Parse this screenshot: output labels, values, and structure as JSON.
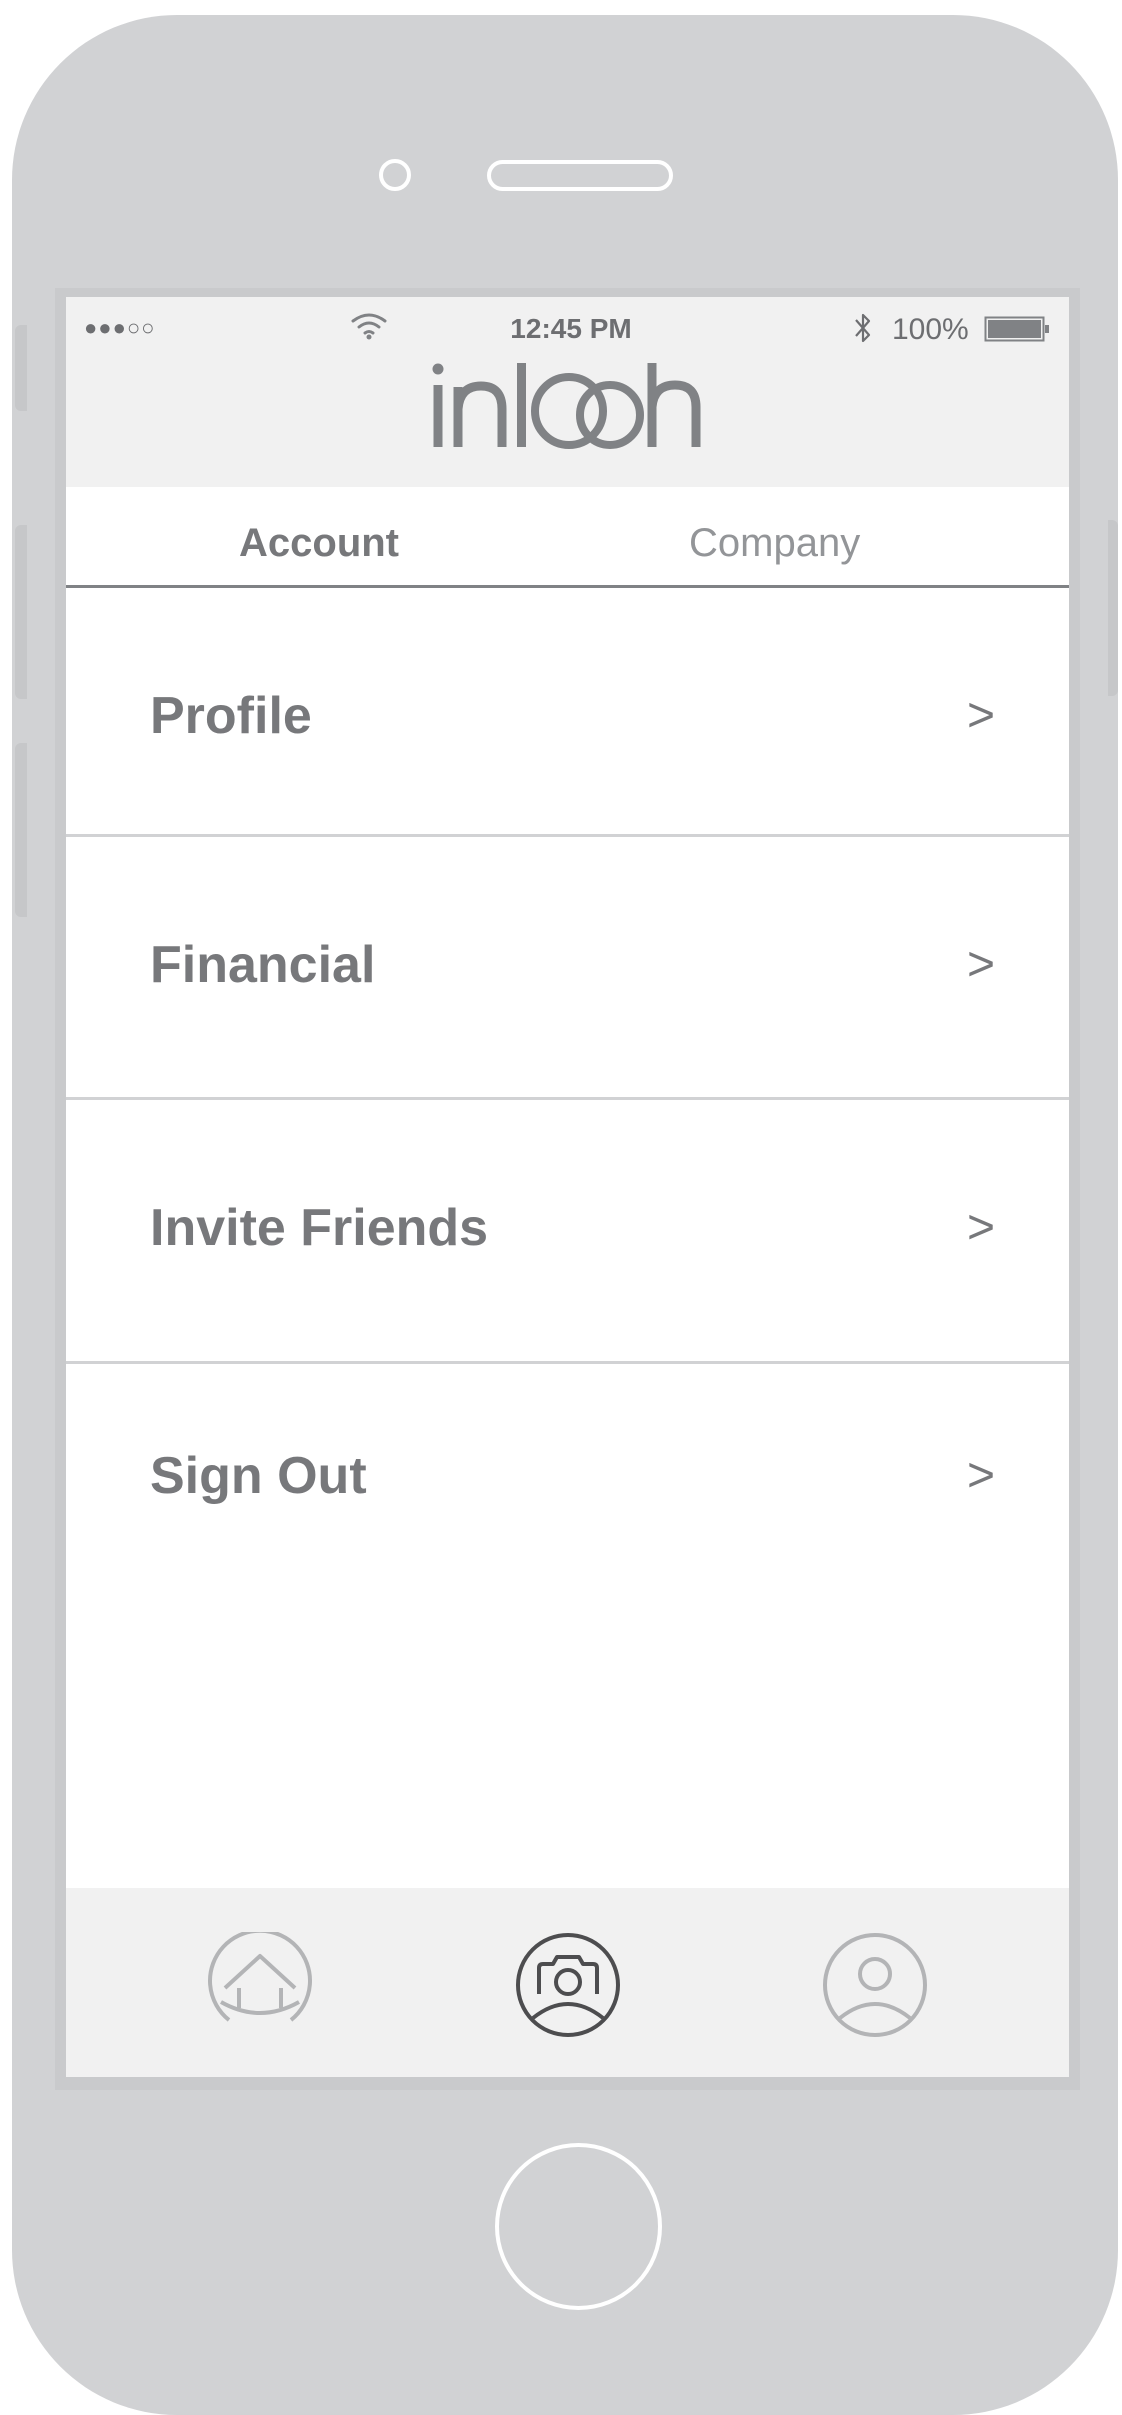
{
  "status_bar": {
    "signal": "●●●○○",
    "time": "12:45 PM",
    "battery": "100%"
  },
  "header": {
    "logo_text": "inlooh"
  },
  "tabs": [
    {
      "label": "Account",
      "active": true
    },
    {
      "label": "Company",
      "active": false
    }
  ],
  "menu": [
    {
      "label": "Profile",
      "chevron": ">"
    },
    {
      "label": "Financial",
      "chevron": ">"
    },
    {
      "label": "Invite Friends",
      "chevron": ">"
    },
    {
      "label": "Sign Out",
      "chevron": ">"
    }
  ],
  "bottom_nav": [
    {
      "icon": "home-icon",
      "active": false
    },
    {
      "icon": "camera-icon",
      "active": true
    },
    {
      "icon": "user-icon",
      "active": false
    }
  ],
  "colors": {
    "phone_body": "#d1d2d4",
    "text_gray": "#77787b",
    "header_bg": "#f1f1f1",
    "active_icon": "#4d4d4f",
    "inactive_icon": "#b3b4b6"
  }
}
